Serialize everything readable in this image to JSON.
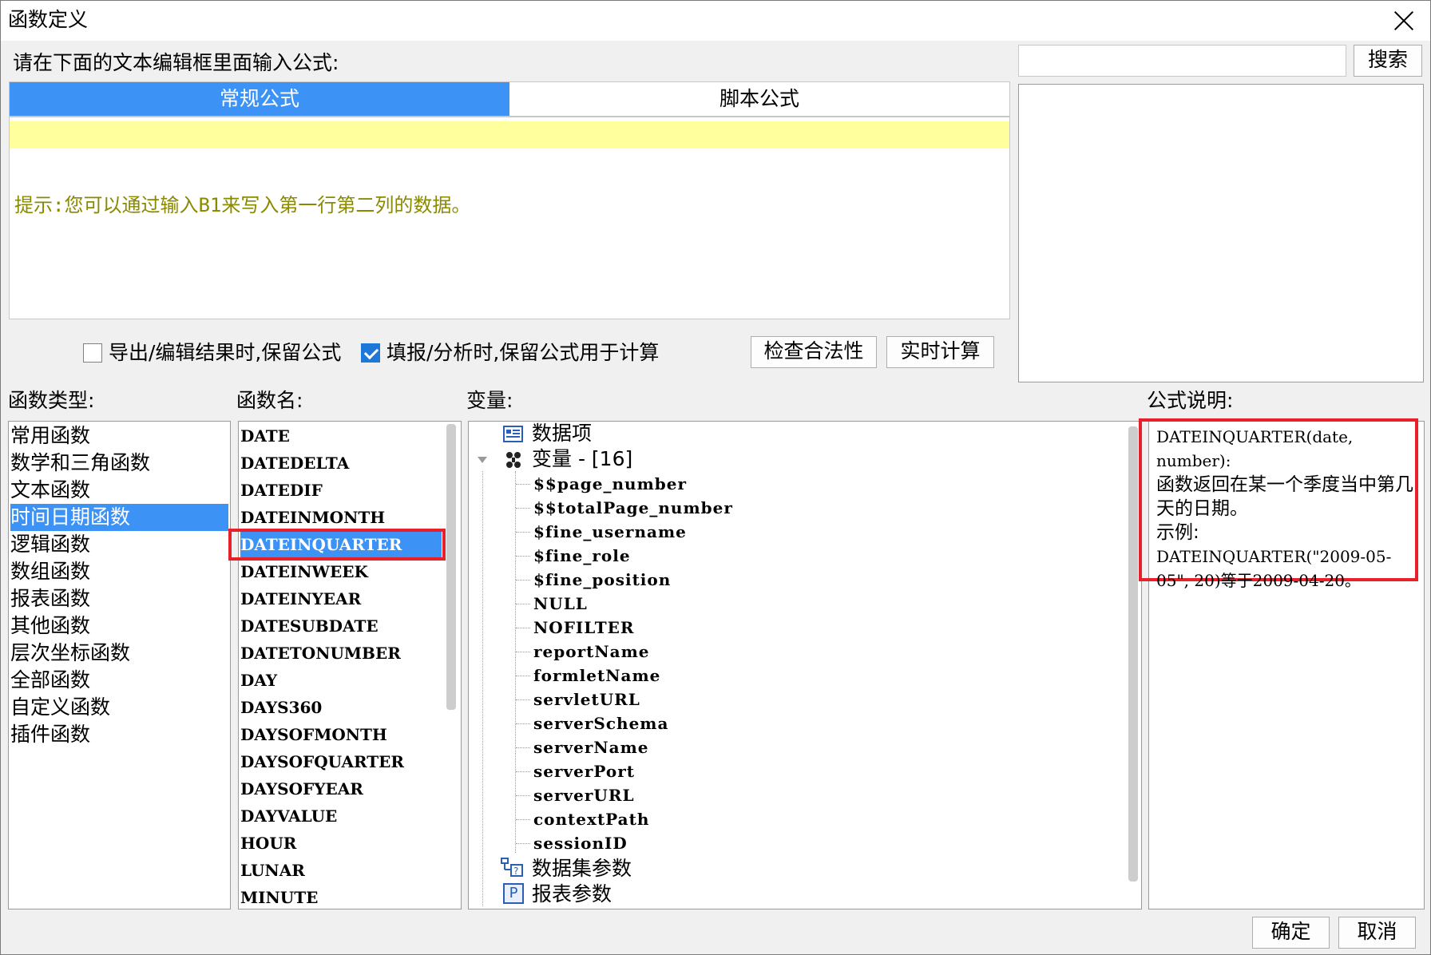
{
  "window": {
    "title": "函数定义"
  },
  "editor": {
    "prompt_label": "请在下面的文本编辑框里面输入公式:",
    "tabs": [
      "常规公式",
      "脚本公式"
    ],
    "hint": "提示:您可以通过输入B1来写入第一行第二列的数据。"
  },
  "options": {
    "keep_formula_export": {
      "label": "导出/编辑结果时,保留公式",
      "checked": false
    },
    "keep_formula_fill": {
      "label": "填报/分析时,保留公式用于计算",
      "checked": true
    },
    "check_validity_button": "检查合法性",
    "realtime_calc_button": "实时计算"
  },
  "search": {
    "button": "搜索",
    "value": ""
  },
  "function_types": {
    "label": "函数类型:",
    "items": [
      "常用函数",
      "数学和三角函数",
      "文本函数",
      "时间日期函数",
      "逻辑函数",
      "数组函数",
      "报表函数",
      "其他函数",
      "层次坐标函数",
      "全部函数",
      "自定义函数",
      "插件函数"
    ],
    "selected": "时间日期函数"
  },
  "function_names": {
    "label": "函数名:",
    "items": [
      "DATE",
      "DATEDELTA",
      "DATEDIF",
      "DATEINMONTH",
      "DATEINQUARTER",
      "DATEINWEEK",
      "DATEINYEAR",
      "DATESUBDATE",
      "DATETONUMBER",
      "DAY",
      "DAYS360",
      "DAYSOFMONTH",
      "DAYSOFQUARTER",
      "DAYSOFYEAR",
      "DAYVALUE",
      "HOUR",
      "LUNAR",
      "MINUTE"
    ],
    "selected": "DATEINQUARTER"
  },
  "variables": {
    "label": "变量:",
    "data_items": "数据项",
    "variables_node": "变量 - [16]",
    "items": [
      "$$page_number",
      "$$totalPage_number",
      "$fine_username",
      "$fine_role",
      "$fine_position",
      "NULL",
      "NOFILTER",
      "reportName",
      "formletName",
      "servletURL",
      "serverSchema",
      "serverName",
      "serverPort",
      "serverURL",
      "contextPath",
      "sessionID"
    ],
    "dataset_params": "数据集参数",
    "report_params": "报表参数"
  },
  "description": {
    "label": "公式说明:",
    "signature": "DATEINQUARTER(date, number):",
    "text": "函数返回在某一个季度当中第几天的日期。",
    "example_label": "示例:",
    "example": "DATEINQUARTER(\"2009-05-05\", 20)等于2009-04-20。"
  },
  "footer": {
    "ok": "确定",
    "cancel": "取消"
  }
}
